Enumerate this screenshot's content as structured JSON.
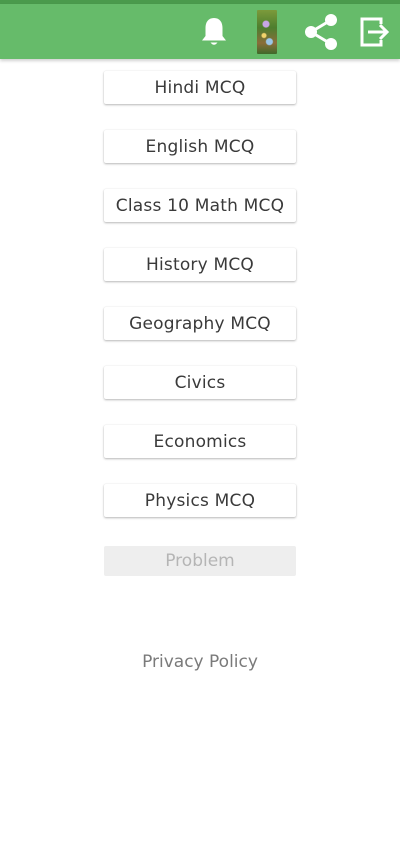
{
  "toolbar": {
    "background": "#66bb6a",
    "icons": [
      "bell-icon",
      "photo-thumbnail",
      "share-icon",
      "exit-icon"
    ]
  },
  "menu": {
    "items": [
      {
        "label": "Hindi MCQ"
      },
      {
        "label": "English MCQ"
      },
      {
        "label": "Class 10 Math MCQ"
      },
      {
        "label": "History MCQ"
      },
      {
        "label": "Geography MCQ"
      },
      {
        "label": "Civics"
      },
      {
        "label": "Economics"
      },
      {
        "label": "Physics MCQ"
      }
    ],
    "problem_label": "Problem"
  },
  "footer": {
    "privacy_label": "Privacy Policy"
  }
}
